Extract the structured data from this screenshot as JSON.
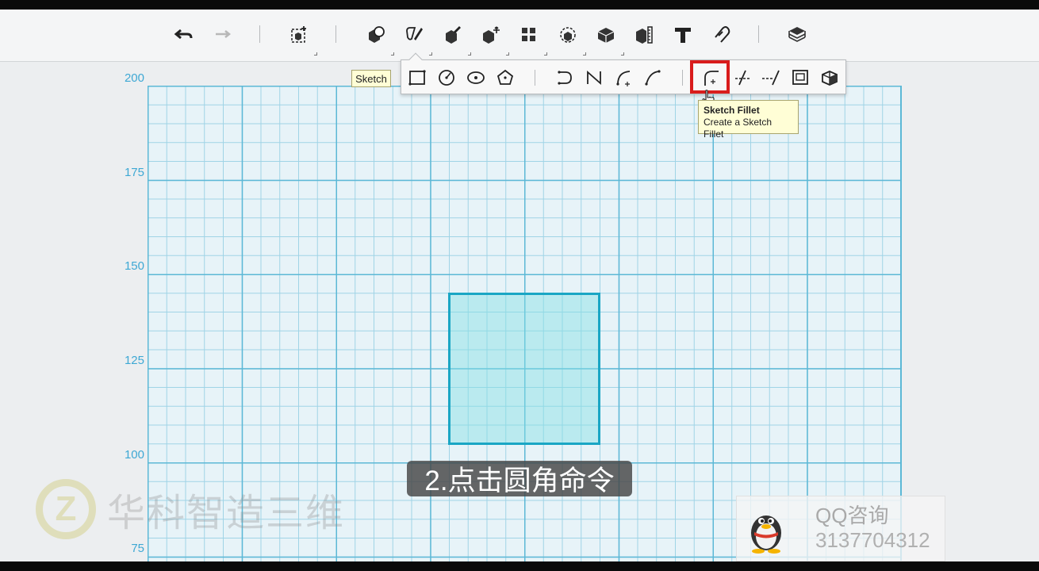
{
  "toolbar": {
    "undo": "undo-icon",
    "redo": "redo-icon",
    "buttons": [
      "new-design-icon",
      "primitives-icon",
      "sketch-icon",
      "construct-icon",
      "modify-icon",
      "pattern-icon",
      "grouping-icon",
      "combine-icon",
      "measure-icon",
      "text-icon",
      "snap-icon",
      "material-icon"
    ]
  },
  "sketch_toolbar": {
    "tooltip": "Sketch",
    "tools": [
      "rectangle-icon",
      "circle-icon",
      "ellipse-icon",
      "polygon-icon",
      "polyline-icon",
      "spline-icon",
      "two-point-arc-icon",
      "three-point-arc-icon",
      "sketch-fillet-icon",
      "trim-icon",
      "extend-icon",
      "offset-icon",
      "project-icon"
    ]
  },
  "fillet_tooltip": {
    "title": "Sketch Fillet",
    "description": "Create a Sketch Fillet"
  },
  "grid": {
    "y_labels": [
      "200",
      "175",
      "150",
      "125",
      "100",
      "75"
    ]
  },
  "subtitle": "2.点击圆角命令",
  "watermark": {
    "logo_letter": "Z",
    "text": "华科智造三维"
  },
  "qq": {
    "title": "QQ咨询",
    "number": "3137704312"
  },
  "colors": {
    "grid_major": "#5cb8d6",
    "grid_minor": "#9fd3e6",
    "shape_fill": "#82e1e4",
    "shape_stroke": "#1aa6c4",
    "highlight": "#d91c1c"
  }
}
